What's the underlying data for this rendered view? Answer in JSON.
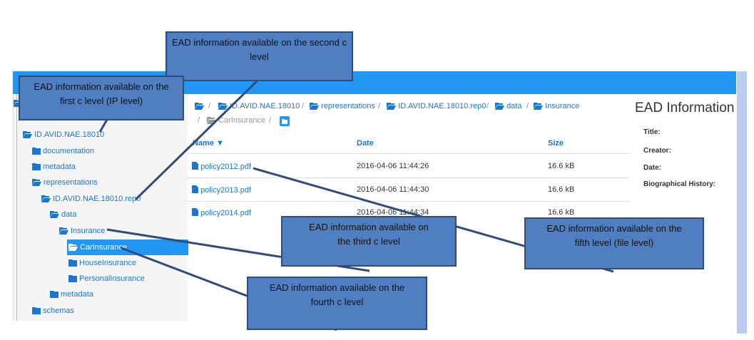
{
  "breadcrumb": {
    "items": [
      "ID.AVID.NAE.18010",
      "representations",
      "ID.AVID.NAE.18010.rep0",
      "data",
      "Insurance",
      "CarInsurance"
    ],
    "separator": "/"
  },
  "sidebar": {
    "items": [
      {
        "label": "ID.AVID.NAE.18010"
      },
      {
        "label": "documentation"
      },
      {
        "label": "metadata"
      },
      {
        "label": "representations"
      },
      {
        "label": "ID.AVID.NAE.18010.rep0"
      },
      {
        "label": "data"
      },
      {
        "label": "Insurance"
      },
      {
        "label": "CarInsurance"
      },
      {
        "label": "HouseInsurance"
      },
      {
        "label": "PersonalInsurance"
      },
      {
        "label": "metadata"
      },
      {
        "label": "schemas"
      }
    ]
  },
  "table": {
    "headers": {
      "name": "Name ▼",
      "date": "Date",
      "size": "Size"
    },
    "rows": [
      {
        "name": "policy2012.pdf",
        "date": "2016-04-06 11:44:26",
        "size": "16.6 kB"
      },
      {
        "name": "policy2013.pdf",
        "date": "2016-04-06 11:44:30",
        "size": "16.6 kB"
      },
      {
        "name": "policy2014.pdf",
        "date": "2016-04-06 11:44:34",
        "size": "16.6 kB"
      }
    ]
  },
  "ead_panel": {
    "title": "EAD Information",
    "labels": [
      "Title:",
      "Creator:",
      "Date:",
      "Biographical History:"
    ]
  },
  "annotations": {
    "first": "EAD information available on the first c level (IP level)",
    "second": "EAD information available on the second c level",
    "third": "EAD information available on the third c level",
    "fourth": "EAD information available on the fourth c level",
    "fifth": "EAD information available on the fifth level (file level)"
  },
  "colors": {
    "accent": "#2196f3",
    "link": "#1976d2",
    "note_fill": "#4f7fc1",
    "note_border": "#2e4d7a",
    "folder": "#1976d2",
    "strip": "#bccdf3"
  },
  "icons": {
    "folder": "folder-icon",
    "folder_open": "folder-open-icon",
    "file": "file-icon"
  }
}
